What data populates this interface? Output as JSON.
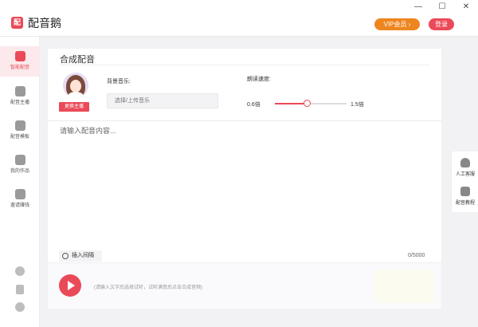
{
  "window": {
    "title": "配音鹅",
    "logo_text": "配",
    "controls": {
      "minimize": "—",
      "maximize": "☐",
      "close": "✕"
    }
  },
  "header": {
    "vip_label": "VIP会员 ›",
    "login_label": "登录"
  },
  "sidebar": {
    "items": [
      {
        "label": "智能配音",
        "icon": "ear-wave-icon",
        "active": true
      },
      {
        "label": "配音主播",
        "icon": "person-icon",
        "active": false
      },
      {
        "label": "配音模板",
        "icon": "template-icon",
        "active": false
      },
      {
        "label": "我的作品",
        "icon": "folder-icon",
        "active": false
      },
      {
        "label": "邀请赚钱",
        "icon": "money-bag-icon",
        "active": false
      }
    ],
    "bottom_icons": [
      "tiktok-icon",
      "phone-icon",
      "settings-icon"
    ]
  },
  "main": {
    "title": "合成配音",
    "change_voice_label": "更换主播",
    "bgm": {
      "label": "背景音乐:",
      "placeholder": "选择/上传音乐"
    },
    "speed": {
      "label": "朗读速度:",
      "min_label": "0.6倍",
      "max_label": "1.5倍",
      "min": 0.6,
      "max": 1.5,
      "value": 1.0
    },
    "content": {
      "placeholder": "请输入配音内容..."
    },
    "insert_pause_label": "插入间隔",
    "char_count": "0/5000",
    "footer_hint": "(请输入文字后选择试听，试听满意后点击合成音频)"
  },
  "right_panel": {
    "items": [
      {
        "label": "人工客服",
        "icon": "headset-icon"
      },
      {
        "label": "配音教程",
        "icon": "book-icon"
      }
    ]
  },
  "colors": {
    "accent": "#ea4a58",
    "vip": "#ee8620",
    "background": "#f2f2f4"
  }
}
